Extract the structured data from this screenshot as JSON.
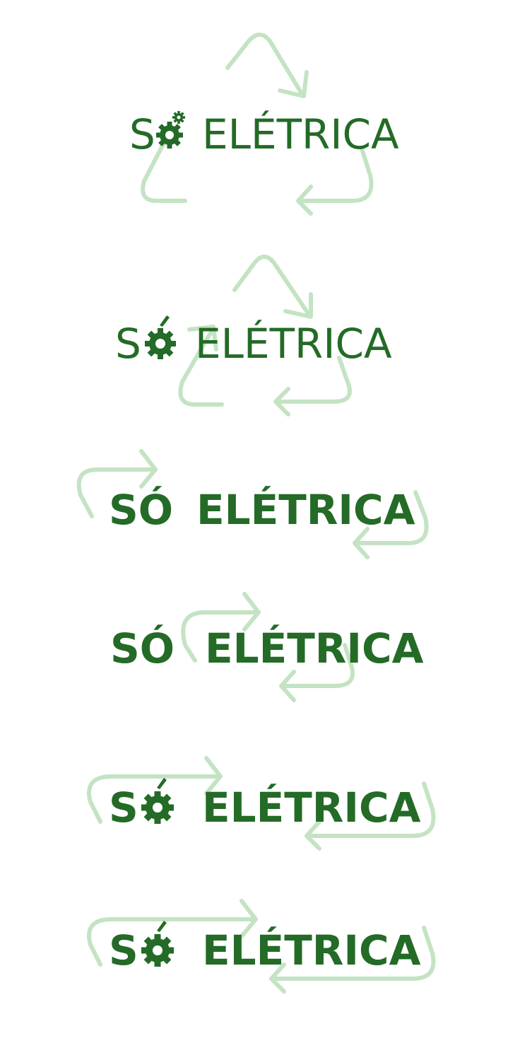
{
  "colors": {
    "text": "#236b26",
    "arrows": "#c4e3c3",
    "background": "#ffffff"
  },
  "variants": [
    {
      "word1": "S",
      "word2": "ELÉTRICA",
      "icon": "small-gear-icon"
    },
    {
      "word1": "S",
      "word2": "ELÉTRICA",
      "icon": "gear-icon"
    },
    {
      "word1": "SÓ",
      "word2": "ELÉTRICA",
      "icon": ""
    },
    {
      "word1": "SÓ",
      "word2": "ELÉTRICA",
      "icon": ""
    },
    {
      "word1": "S",
      "word2": "ELÉTRICA",
      "icon": "gear-icon"
    },
    {
      "word1": "S",
      "word2": "ELÉTRICA",
      "icon": "gear-icon"
    }
  ]
}
